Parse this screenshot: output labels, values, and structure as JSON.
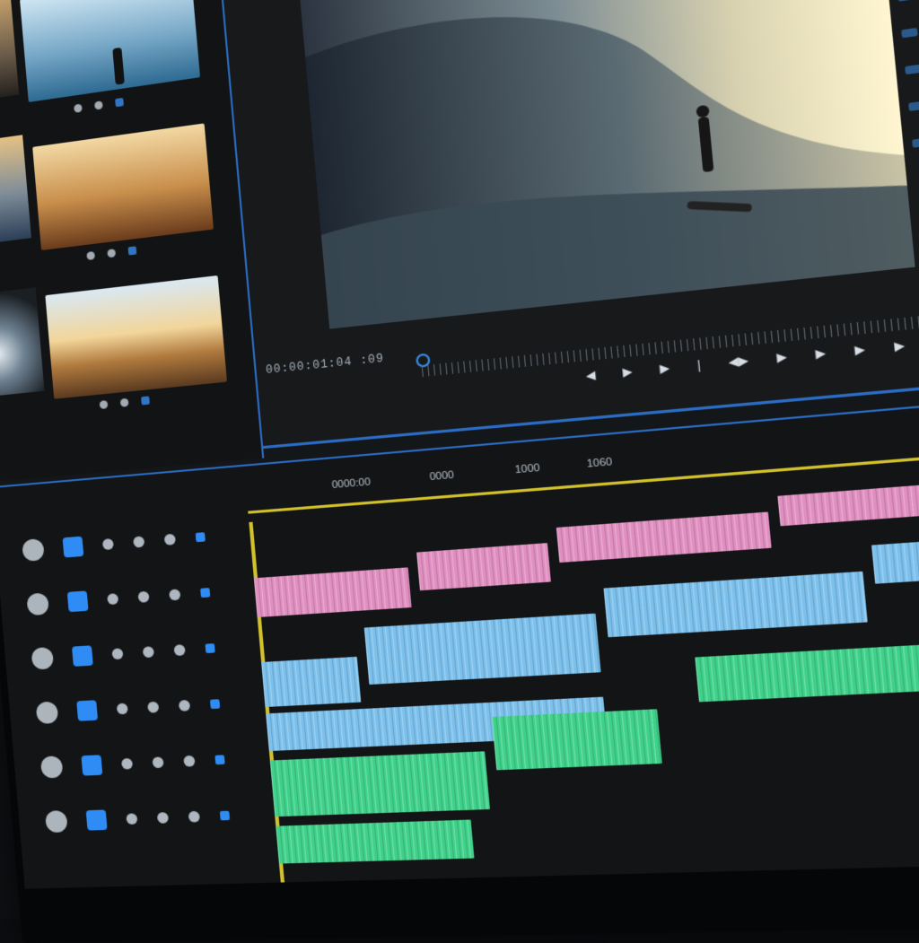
{
  "viewer": {
    "timecode": "00:00:01:04  :09",
    "transport": [
      "◀",
      "▶",
      "▶",
      "|",
      "◀▶",
      "▶",
      "▶",
      "▶",
      "▶"
    ]
  },
  "timeline": {
    "labels": [
      "0000:00",
      "0000",
      "1000",
      "1060"
    ]
  },
  "colors": {
    "accent": "#2b6cc4",
    "ruler": "#d2c02c",
    "audio_pink": "#e08fc0",
    "audio_blue": "#7cc0ec",
    "audio_green": "#3fd18a"
  },
  "icons": {
    "transport": [
      "rewind-icon",
      "play-icon",
      "step-forward-icon",
      "marker-icon",
      "loop-icon",
      "play-icon",
      "step-icon",
      "step-icon",
      "play-icon"
    ]
  }
}
